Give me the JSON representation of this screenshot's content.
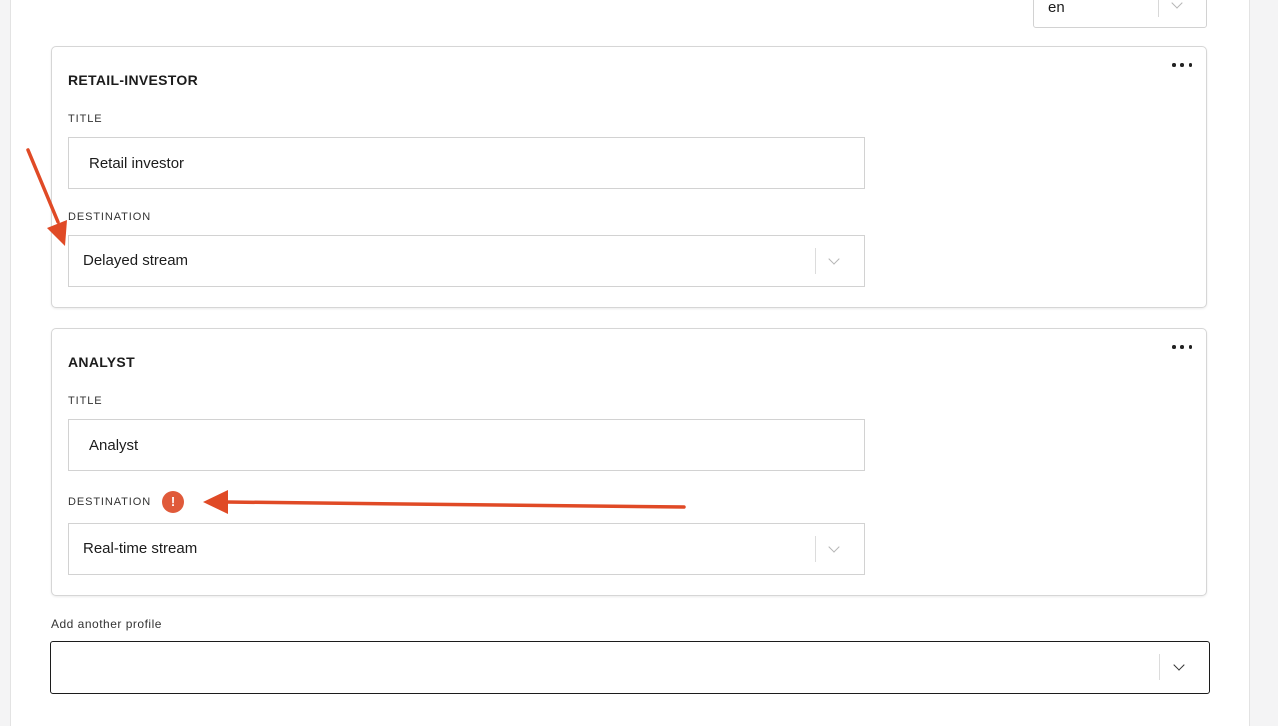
{
  "language_select": {
    "value": "en"
  },
  "profiles": [
    {
      "heading": "RETAIL-INVESTOR",
      "title_label": "TITLE",
      "title_value": "Retail investor",
      "destination_label": "DESTINATION",
      "destination_value": "Delayed stream",
      "has_warning": false
    },
    {
      "heading": "ANALYST",
      "title_label": "TITLE",
      "title_value": "Analyst",
      "destination_label": "DESTINATION",
      "destination_value": "Real-time stream",
      "has_warning": true,
      "warning_symbol": "!"
    }
  ],
  "add_profile": {
    "label": "Add another profile",
    "value": ""
  },
  "icons": {
    "menu": "more-horizontal-icon",
    "dropdown": "chevron-down-icon",
    "warning": "warning-icon"
  },
  "colors": {
    "warning": "#e05a3a",
    "annotation_arrow": "#e04a26",
    "border": "#d2d2d2",
    "text": "#1c1c1c"
  }
}
